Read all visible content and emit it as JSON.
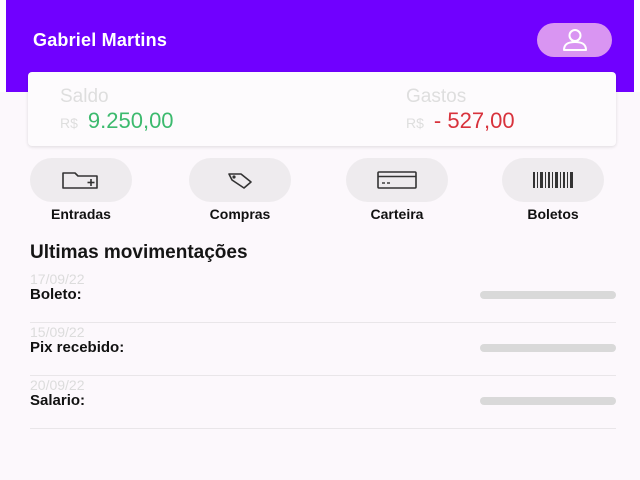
{
  "header": {
    "user_name": "Gabriel Martins",
    "avatar_icon": "user-icon",
    "color": "#7000ff"
  },
  "balance": {
    "saldo_label": "Saldo",
    "saldo_currency": "R$",
    "saldo_value": "9.250,00",
    "gastos_label": "Gastos",
    "gastos_currency": "R$",
    "gastos_value": "- 527,00"
  },
  "actions": [
    {
      "label": "Entradas",
      "icon": "folder-add-icon"
    },
    {
      "label": "Compras",
      "icon": "tag-icon"
    },
    {
      "label": "Carteira",
      "icon": "credit-card-icon"
    },
    {
      "label": "Boletos",
      "icon": "barcode-icon"
    }
  ],
  "movements": {
    "title": "Ultimas movimentações",
    "items": [
      {
        "date": "17/09/22",
        "name": "Boleto:"
      },
      {
        "date": "15/09/22",
        "name": "Pix recebido:"
      },
      {
        "date": "20/09/22",
        "name": "Salario:"
      }
    ]
  },
  "colors": {
    "positive": "#3cba6e",
    "negative": "#d8323c"
  }
}
